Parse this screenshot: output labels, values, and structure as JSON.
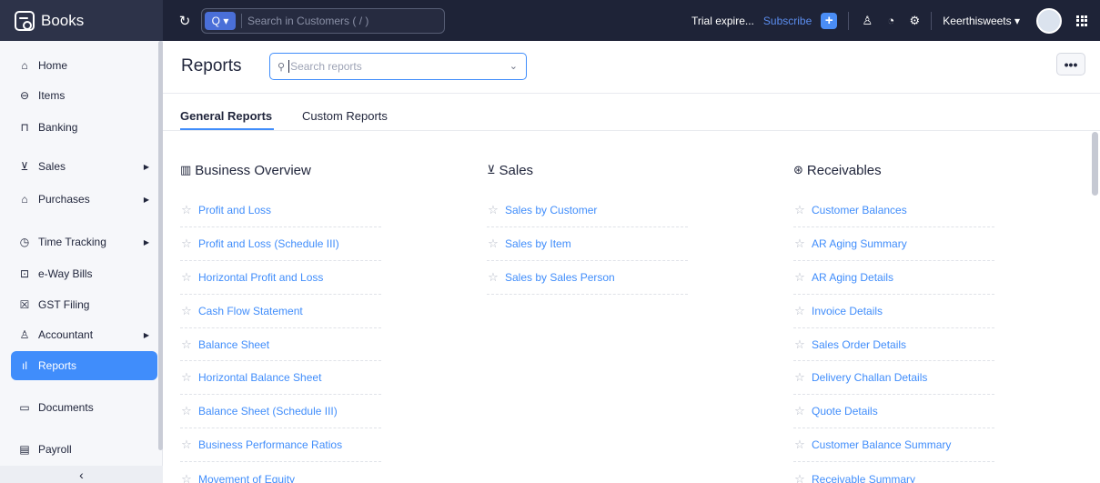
{
  "app": {
    "name": "Books"
  },
  "topbar": {
    "search_scope": "Q",
    "search_placeholder": "Search in Customers ( / )",
    "trial_text": "Trial expire...",
    "subscribe_label": "Subscribe",
    "add_label": "+",
    "org_name": "Keerthisweets"
  },
  "sidebar": {
    "items": [
      {
        "label": "Home",
        "icon": "home-icon",
        "glyph": "⌂"
      },
      {
        "label": "Items",
        "icon": "items-icon",
        "glyph": "⛉"
      },
      {
        "label": "Banking",
        "icon": "bank-icon",
        "glyph": "⌂"
      },
      {
        "label": "Sales",
        "icon": "cart-icon",
        "glyph": "⛟"
      },
      {
        "label": "Purchases",
        "icon": "bag-icon",
        "glyph": "⌂"
      },
      {
        "label": "Time Tracking",
        "icon": "timer-icon",
        "glyph": "◷"
      },
      {
        "label": "e-Way Bills",
        "icon": "truck-icon",
        "glyph": "⛟"
      },
      {
        "label": "GST Filing",
        "icon": "gst-icon",
        "glyph": "▣"
      },
      {
        "label": "Accountant",
        "icon": "accountant-icon",
        "glyph": "♙"
      },
      {
        "label": "Reports",
        "icon": "reports-icon",
        "glyph": "▮"
      },
      {
        "label": "Documents",
        "icon": "folder-icon",
        "glyph": "▭"
      },
      {
        "label": "Payroll",
        "icon": "payroll-icon",
        "glyph": "▤"
      }
    ],
    "collapse_glyph": "‹"
  },
  "main": {
    "title": "Reports",
    "search_placeholder": "Search reports",
    "more_label": "•••",
    "tabs": [
      {
        "label": "General Reports",
        "active": true
      },
      {
        "label": "Custom Reports",
        "active": false
      }
    ],
    "groups": [
      {
        "title": "Business Overview",
        "icon": "building-icon",
        "reports": [
          "Profit and Loss",
          "Profit and Loss (Schedule III)",
          "Horizontal Profit and Loss",
          "Cash Flow Statement",
          "Balance Sheet",
          "Horizontal Balance Sheet",
          "Balance Sheet (Schedule III)",
          "Business Performance Ratios",
          "Movement of Equity"
        ]
      },
      {
        "title": "Sales",
        "icon": "cart-icon",
        "reports": [
          "Sales by Customer",
          "Sales by Item",
          "Sales by Sales Person"
        ]
      },
      {
        "title": "Receivables",
        "icon": "receivables-icon",
        "reports": [
          "Customer Balances",
          "AR Aging Summary",
          "AR Aging Details",
          "Invoice Details",
          "Sales Order Details",
          "Delivery Challan Details",
          "Quote Details",
          "Customer Balance Summary",
          "Receivable Summary"
        ]
      }
    ]
  },
  "colors": {
    "topbar": "#1e2337",
    "accent": "#408dfb",
    "link": "#408dfb"
  }
}
